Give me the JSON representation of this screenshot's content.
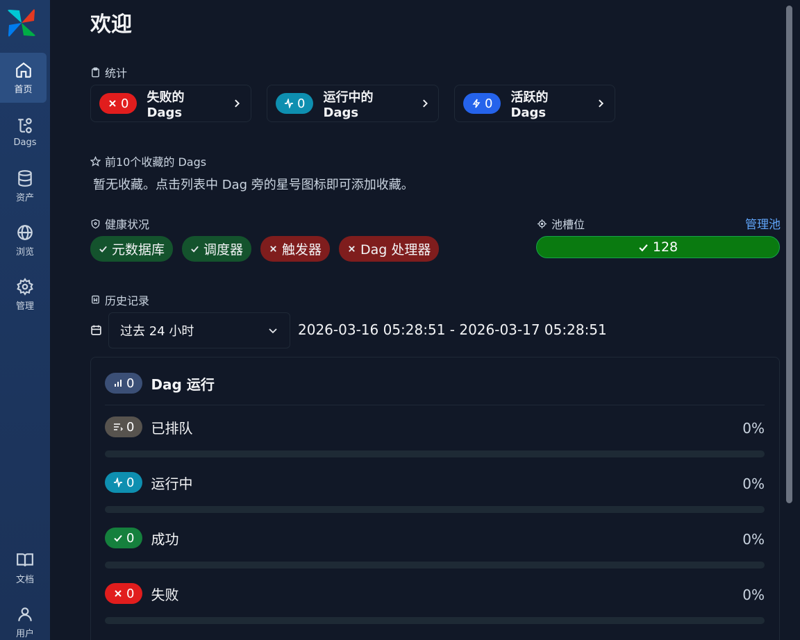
{
  "sidebar": {
    "items": [
      {
        "label": "首页",
        "icon": "home-icon"
      },
      {
        "label": "Dags",
        "icon": "dags-icon"
      },
      {
        "label": "资产",
        "icon": "database-icon"
      },
      {
        "label": "浏览",
        "icon": "globe-icon"
      },
      {
        "label": "管理",
        "icon": "gear-icon"
      },
      {
        "label": "文档",
        "icon": "book-icon"
      },
      {
        "label": "用户",
        "icon": "user-icon"
      }
    ]
  },
  "page": {
    "title": "欢迎"
  },
  "stats": {
    "label": "统计",
    "cards": [
      {
        "count": "0",
        "label": "失败的 Dags",
        "color": "#e11d1d"
      },
      {
        "count": "0",
        "label": "运行中的 Dags",
        "color": "#0e8fb0"
      },
      {
        "count": "0",
        "label": "活跃的 Dags",
        "color": "#2563eb"
      }
    ]
  },
  "favorites": {
    "label": "前10个收藏的 Dags",
    "empty_message": "暂无收藏。点击列表中 Dag 旁的星号图标即可添加收藏。"
  },
  "health": {
    "label": "健康状况",
    "items": [
      {
        "label": "元数据库",
        "status": "ok"
      },
      {
        "label": "调度器",
        "status": "ok"
      },
      {
        "label": "触发器",
        "status": "error"
      },
      {
        "label": "Dag 处理器",
        "status": "error"
      }
    ]
  },
  "pool": {
    "label": "池槽位",
    "manage_label": "管理池",
    "value": "128"
  },
  "history": {
    "label": "历史记录",
    "range_select": "过去 24 小时",
    "range_text": "2026-03-16 05:28:51 - 2026-03-17 05:28:51",
    "dag_runs": {
      "count": "0",
      "label": "Dag 运行"
    },
    "rows": [
      {
        "count": "0",
        "label": "已排队",
        "percent": "0%",
        "fraction": 0
      },
      {
        "count": "0",
        "label": "运行中",
        "percent": "0%",
        "fraction": 0
      },
      {
        "count": "0",
        "label": "成功",
        "percent": "0%",
        "fraction": 0
      },
      {
        "count": "0",
        "label": "失败",
        "percent": "0%",
        "fraction": 0
      }
    ]
  },
  "colors": {
    "sidebar": "#1e3a66",
    "background": "#111827",
    "success": "#15803d",
    "failed": "#e11d1d",
    "running": "#0e8fb0",
    "link": "#60a5fa"
  }
}
